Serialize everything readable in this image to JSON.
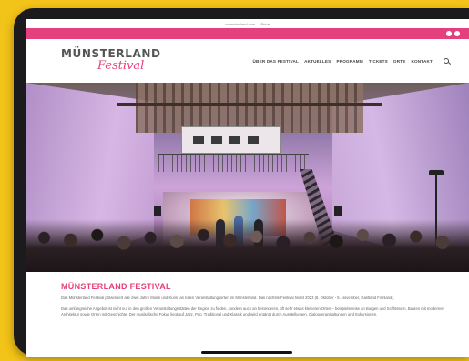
{
  "browser": {
    "url": "muensterland.com — Privat"
  },
  "topbar": {
    "social": [
      "facebook-icon",
      "instagram-icon"
    ],
    "color": "#e5407e"
  },
  "logo": {
    "main": "MÜNSTERLAND",
    "script": "Festival"
  },
  "nav": {
    "items": [
      "ÜBER DAS FESTIVAL",
      "AKTUELLES",
      "PROGRAMM",
      "TICKETS",
      "ORTE",
      "KONTAKT"
    ]
  },
  "hero": {
    "image": "concert-in-church-hall-photo"
  },
  "content": {
    "heading": "MÜNSTERLAND FESTIVAL",
    "paragraph1": "Das Münsterland Festival präsentiert alle zwei Jahre Musik und Kunst an tollen Veranstaltungsorten im Münsterland. Das nächste Festival findet 2023 (6. Oktober - 5. November, Gastland Finnland).",
    "paragraph2": "Das umfangreiche Angebot ist nicht nur in den großen Veranstaltungsstätten der Region zu finden, sondern auch an besonderen, oft sehr etwas kleineren Orten – beispielsweise an Burgen und Schlössern, Bauten mit moderner Architektur sowie Orten mit Geschichte. Der musikalische Fokus liegt auf Jazz, Pop, Traditional und Klassik und wird ergänzt durch Ausstellungen, Dialogveranstaltungen und Exkursionen."
  },
  "colors": {
    "accent": "#e5407e",
    "frame": "#f2c318",
    "device": "#1b1b1d"
  }
}
